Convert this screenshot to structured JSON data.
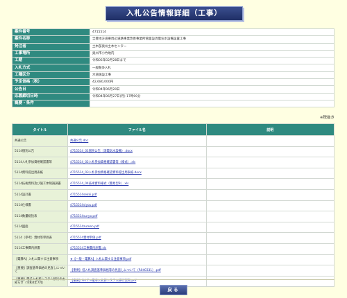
{
  "page_title": "入札公告情報詳細（工事）",
  "info_rows": [
    {
      "label": "案件番号",
      "value": "4715514"
    },
    {
      "label": "案件名称",
      "value": "全豊地方道東周辺道路事業改善事業所管面設消電気水設備設置工事"
    },
    {
      "label": "発注者",
      "value": "土木部奥州土木センター"
    },
    {
      "label": "工事場所",
      "value": "奥州市小竹地内"
    },
    {
      "label": "工期",
      "value": "令和05年02月28日まで"
    },
    {
      "label": "入札方式",
      "value": "一般競争入札"
    },
    {
      "label": "工種区分",
      "value": "水道施設工事"
    },
    {
      "label": "予定価格（税）",
      "value": "42,680,000円"
    },
    {
      "label": "公告日",
      "value": "令和04年06月20日"
    },
    {
      "label": "応募締切日時",
      "value": "令和04年06月27日(月) 17時00分"
    },
    {
      "label": "概要・条件",
      "value": ""
    }
  ],
  "note": "※税抜き",
  "files_header": {
    "title": "タイトル",
    "file": "ファイル名",
    "desc": "説明"
  },
  "files": [
    {
      "title": "共通公告",
      "file": "共通公告.doc",
      "desc": ""
    },
    {
      "title": "5114個別公告",
      "file": "4715514_01個別公告（消電気水設備）.docx",
      "desc": ""
    },
    {
      "title": "5114入札参加資格確認書等",
      "file": "4715514_02入札参加資格確認書等（様式）.xls",
      "desc": ""
    },
    {
      "title": "5114資料提出用表紙",
      "file": "4715514_03入札参加資格確認資料提出用表紙.docx",
      "desc": ""
    },
    {
      "title": "5114技術資料及び施工体制調調書",
      "file": "4715514_04技術資料様式（簡易型B）.xls",
      "desc": ""
    },
    {
      "title": "5114設計書",
      "file": "4715514sekki.pdf",
      "desc": ""
    },
    {
      "title": "5114仕様書",
      "file": "4715514siyou.pdf",
      "desc": ""
    },
    {
      "title": "5114数量総括表",
      "file": "4715514suryo.pdf",
      "desc": ""
    },
    {
      "title": "5114図面",
      "file": "4715514zumen.pdf",
      "desc": ""
    },
    {
      "title": "5114（参考）資材等単価表",
      "file": "4715514資材単価.pdf",
      "desc": ""
    },
    {
      "title": "5114工事費内訳書",
      "file": "4715514工事費内訳書.xls",
      "desc": ""
    },
    {
      "title": "【電算A】入札に関する注意事項",
      "file": "★【一般・電算A】入札に関する注意事項.pdf",
      "desc": ""
    },
    {
      "title": "【重要】調査基準価格の見直しについて",
      "file": "【重要】低入札調査基準価格等の見直しについて（R040331）.pdf",
      "desc": ""
    },
    {
      "title": "【重要】電子入札新システム移行のお知らせ（令和4年7月）",
      "file": "【重要】R4.7〜電子入札新システム移行案内.pdf",
      "desc": ""
    }
  ],
  "back_label": "戻る"
}
